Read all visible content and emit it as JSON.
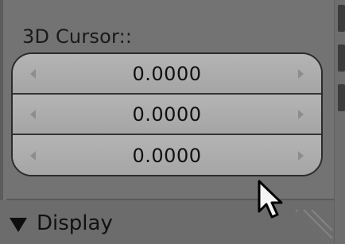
{
  "panel": {
    "section_label": "3D Cursor::",
    "fields": [
      {
        "value": "0.0000"
      },
      {
        "value": "0.0000"
      },
      {
        "value": "0.0000"
      }
    ],
    "display_label": "Display"
  }
}
